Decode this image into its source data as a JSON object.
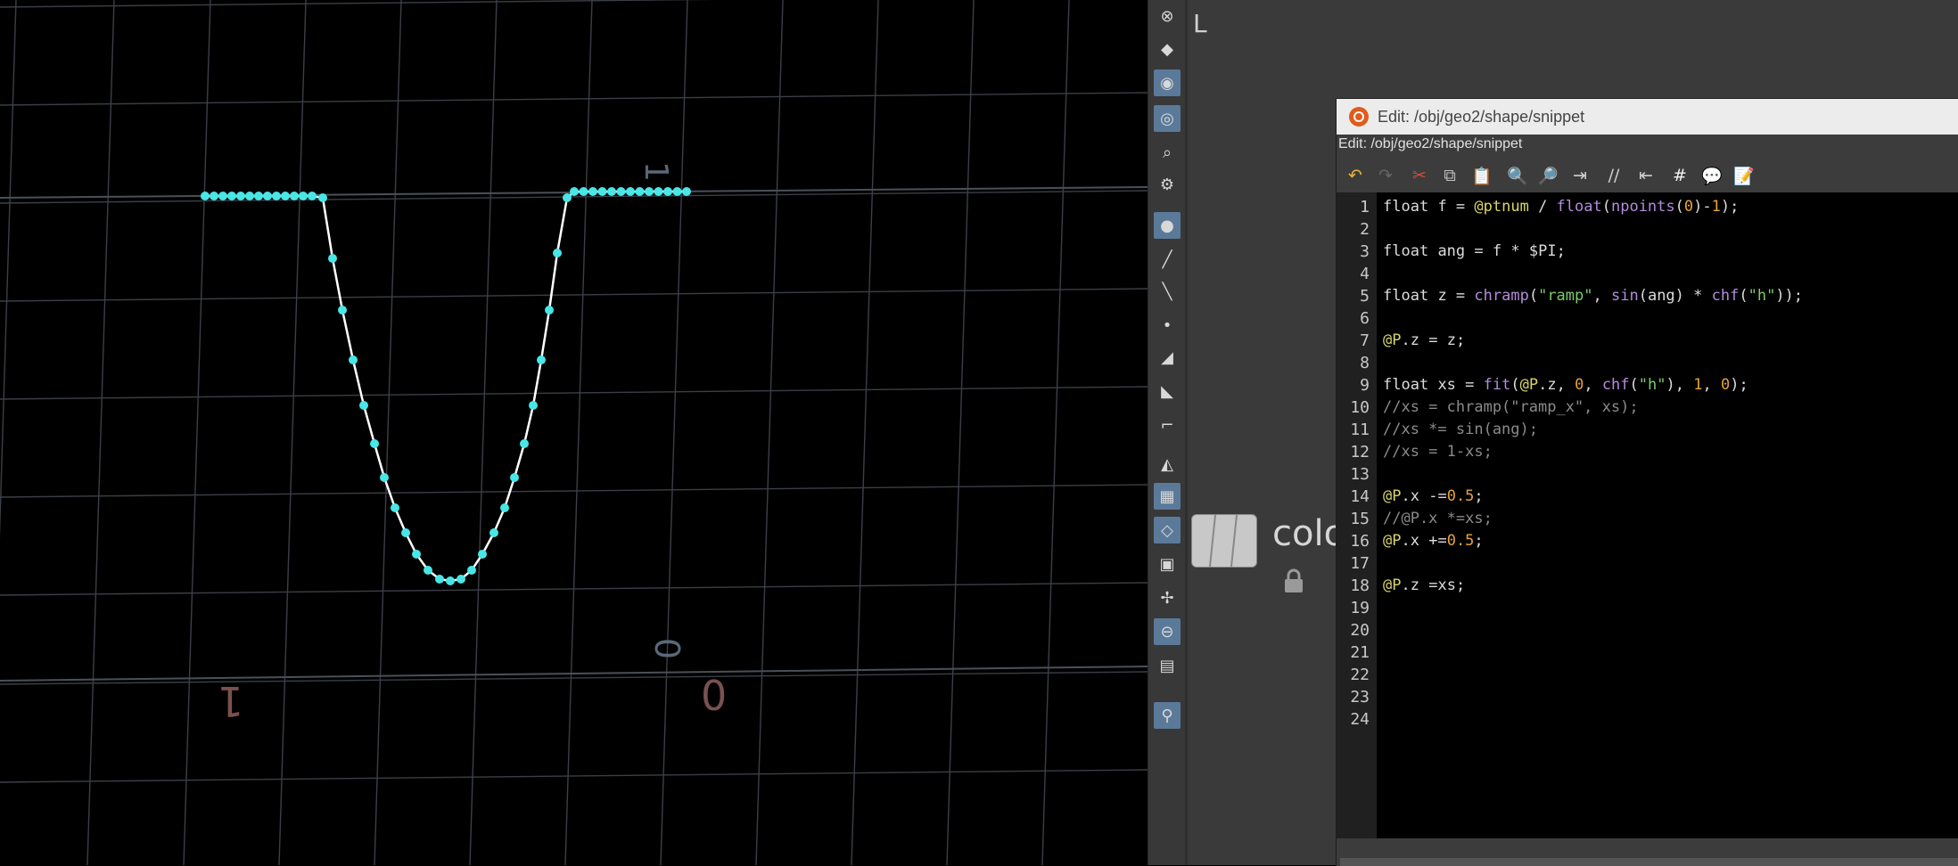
{
  "viewport": {
    "axis_labels": [
      {
        "text": "1"
      },
      {
        "text": "0"
      },
      {
        "text": "0"
      },
      {
        "text": "1"
      }
    ],
    "colors": {
      "background": "#000000",
      "grid": "#3b3f46",
      "curve": "#ffffff",
      "points": "#48e6e6"
    }
  },
  "network": {
    "node_label": "colo",
    "icons": [
      "node-shape-icon",
      "lock-icon"
    ]
  },
  "toolbar": {
    "top_label": "L",
    "icons": [
      "close-icon",
      "snap-icon",
      "light-icon",
      "display-icon",
      "visibility-icon",
      "render-icon",
      "point-icon",
      "brush-icon",
      "pen-icon",
      "point-number-icon",
      "prim-icon",
      "prim-number-icon",
      "normal-icon",
      "shade-icon",
      "texture-icon",
      "template-icon",
      "uv-icon",
      "axis-icon",
      "background-icon",
      "image-icon",
      "location-icon"
    ]
  },
  "editor": {
    "title": "Edit: /obj/geo2/shape/snippet",
    "path": "Edit: /obj/geo2/shape/snippet",
    "tool_icons": [
      "undo-icon",
      "redo-icon",
      "cut-icon",
      "copy-icon",
      "paste-icon",
      "find-icon",
      "find-replace-icon",
      "indent-icon",
      "comment-icon",
      "uncomment-icon",
      "hash-icon",
      "speech-icon",
      "notes-icon"
    ],
    "line_numbers": [
      "1",
      "2",
      "3",
      "4",
      "5",
      "6",
      "7",
      "8",
      "9",
      "10",
      "11",
      "12",
      "13",
      "14",
      "15",
      "16",
      "17",
      "18",
      "19",
      "20",
      "21",
      "22",
      "23",
      "24"
    ],
    "code": [
      "float f = @ptnum / float(npoints(0)-1);",
      "",
      "float ang = f * $PI;",
      "",
      "float z = chramp(\"ramp\", sin(ang) * chf(\"h\"));",
      "",
      "@P.z = z;",
      "",
      "float xs = fit(@P.z, 0, chf(\"h\"), 1, 0);",
      "//xs = chramp(\"ramp_x\", xs);",
      "//xs *= sin(ang);",
      "//xs = 1-xs;",
      "",
      "@P.x -=0.5;",
      "//@P.x *=xs;",
      "@P.x +=0.5;",
      "",
      "@P.z =xs;",
      "",
      "",
      "",
      "",
      "",
      ""
    ],
    "colors": {
      "function": "#b38cdc",
      "number": "#e8a23a",
      "string": "#7ecb6a",
      "attribute": "#d8d46a",
      "comment": "#8a8a8a"
    }
  }
}
